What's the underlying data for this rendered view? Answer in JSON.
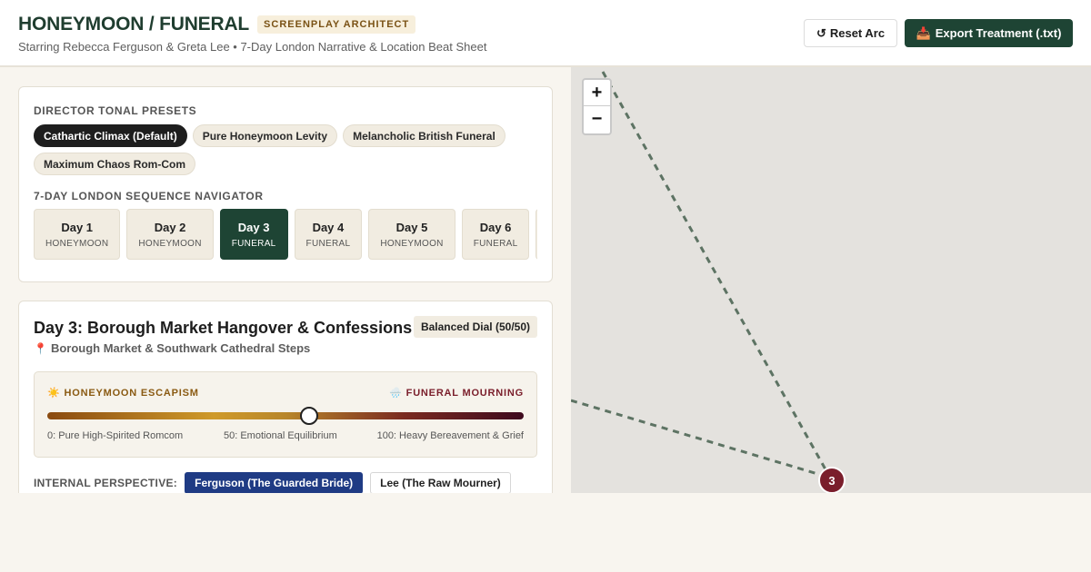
{
  "header": {
    "title": "HONEYMOON / FUNERAL",
    "badge": "SCREENPLAY ARCHITECT",
    "subtitle": "Starring Rebecca Ferguson & Greta Lee • 7-Day London Narrative & Location Beat Sheet",
    "reset_icon": "↺",
    "reset_label": "Reset Arc",
    "export_icon": "📥",
    "export_label": "Export Treatment (.txt)"
  },
  "presets": {
    "label": "DIRECTOR TONAL PRESETS",
    "items": [
      {
        "label": "Cathartic Climax (Default)",
        "active": true
      },
      {
        "label": "Pure Honeymoon Levity",
        "active": false
      },
      {
        "label": "Melancholic British Funeral",
        "active": false
      },
      {
        "label": "Maximum Chaos Rom-Com",
        "active": false
      }
    ]
  },
  "navigator": {
    "label": "7-DAY LONDON SEQUENCE NAVIGATOR",
    "days": [
      {
        "num": "Day 1",
        "type": "HONEYMOON",
        "active": false
      },
      {
        "num": "Day 2",
        "type": "HONEYMOON",
        "active": false
      },
      {
        "num": "Day 3",
        "type": "FUNERAL",
        "active": true
      },
      {
        "num": "Day 4",
        "type": "FUNERAL",
        "active": false
      },
      {
        "num": "Day 5",
        "type": "HONEYMOON",
        "active": false
      },
      {
        "num": "Day 6",
        "type": "FUNERAL",
        "active": false
      }
    ]
  },
  "day": {
    "title": "Day 3: Borough Market Hangover & Confessions",
    "dial_badge": "Balanced Dial (50/50)",
    "pin_icon": "📍",
    "location": "Borough Market & Southwark Cathedral Steps",
    "dial": {
      "left_icon": "☀️",
      "left_label": "HONEYMOON ESCAPISM",
      "right_icon": "🌧️",
      "right_label": "FUNERAL MOURNING",
      "value": 55,
      "max": 100,
      "tick_0": "0: Pure High-Spirited Romcom",
      "tick_50": "50: Emotional Equilibrium",
      "tick_100": "100: Heavy Bereavement & Grief"
    },
    "perspective": {
      "label": "INTERNAL PERSPECTIVE:",
      "options": [
        {
          "label": "Ferguson (The Guarded Bride)",
          "active": true
        },
        {
          "label": "Lee (The Raw Mourner)",
          "active": false
        }
      ]
    }
  },
  "map": {
    "zoom_in": "+",
    "zoom_out": "−",
    "marker_label": "3",
    "route_color": "#5d7363",
    "marker_color": "#7a1e2b"
  }
}
